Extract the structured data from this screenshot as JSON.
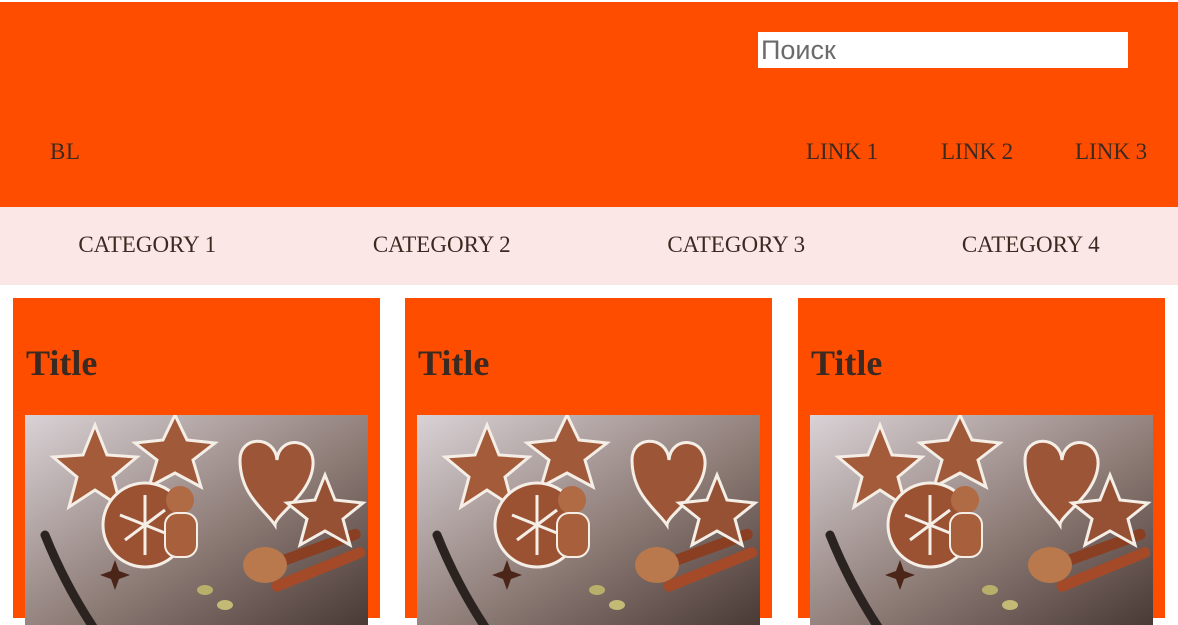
{
  "colors": {
    "header_bg": "#ff4d00",
    "category_bg": "#fae7e6",
    "card_bg": "#ff4d00",
    "text": "#3a2a22"
  },
  "search": {
    "placeholder": "Поиск",
    "value": ""
  },
  "header": {
    "logo": "BL",
    "links": [
      "LINK 1",
      "LINK 2",
      "LINK 3"
    ]
  },
  "categories": [
    "CATEGORY 1",
    "CATEGORY 2",
    "CATEGORY 3",
    "CATEGORY 4"
  ],
  "cards": [
    {
      "title": "Title",
      "image": "gingerbread-cookies-image"
    },
    {
      "title": "Title",
      "image": "gingerbread-cookies-image"
    },
    {
      "title": "Title",
      "image": "gingerbread-cookies-image"
    }
  ]
}
